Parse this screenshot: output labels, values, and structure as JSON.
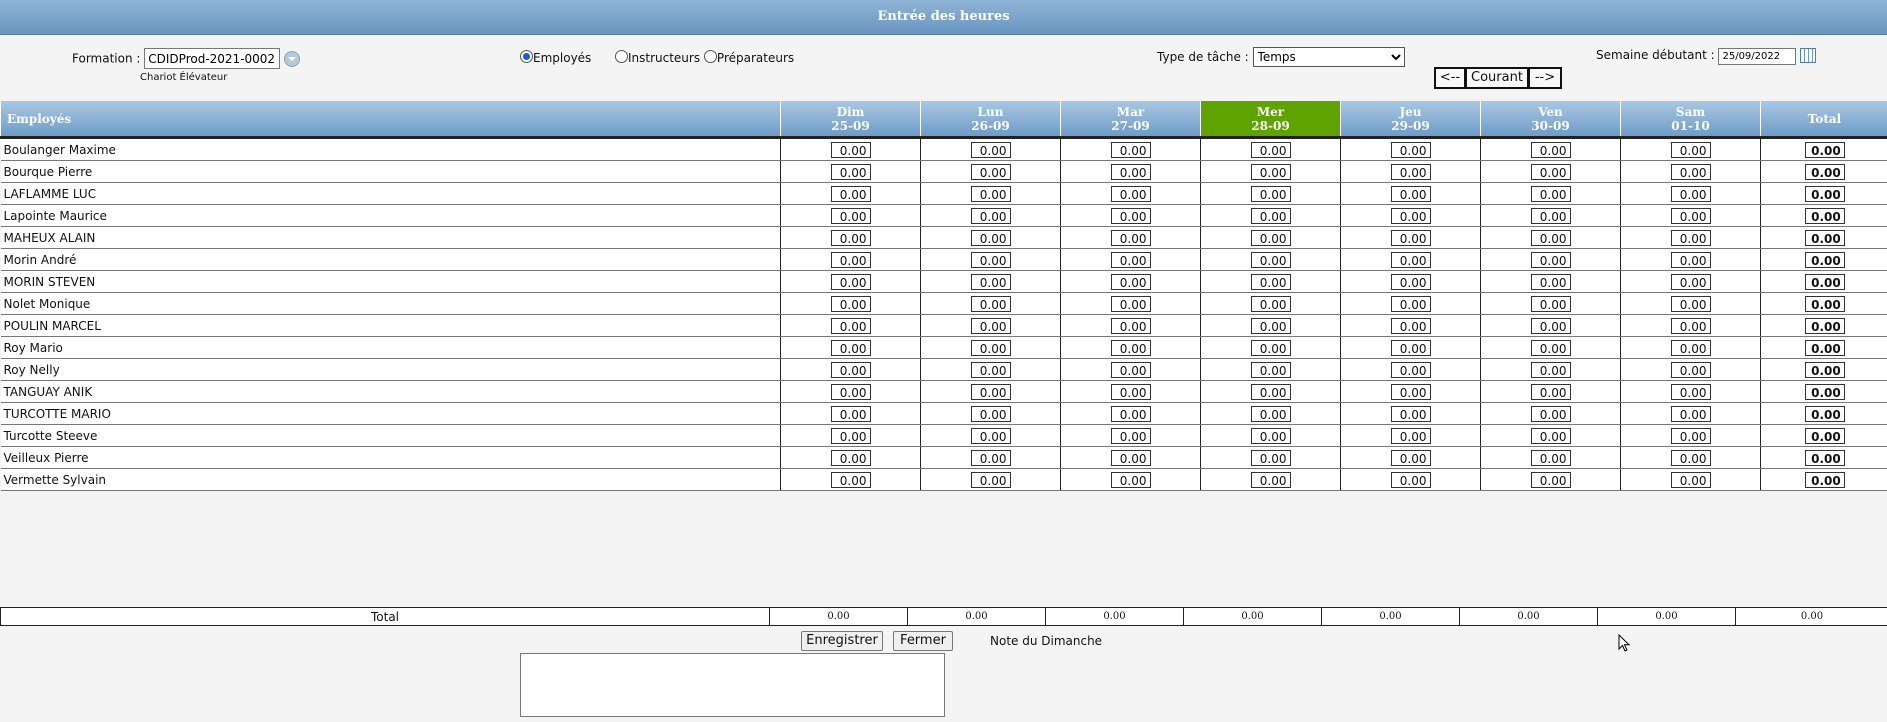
{
  "title": "Entrée des heures",
  "formation": {
    "label": "Formation :",
    "value": "CDIDProd-2021-0002",
    "subtitle": "Chariot Élévateur"
  },
  "radios": [
    {
      "label": "Employés",
      "checked": true
    },
    {
      "label": "Instructeurs",
      "checked": false
    },
    {
      "label": "Préparateurs",
      "checked": false
    }
  ],
  "task_type": {
    "label": "Type de tâche :",
    "value": "Temps"
  },
  "week": {
    "label": "Semaine débutant :",
    "value": "25/09/2022"
  },
  "nav": {
    "prev": "<--",
    "current": "Courant",
    "next": "-->"
  },
  "table": {
    "header_label": "Employés",
    "days": [
      {
        "day": "Dim",
        "date": "25-09",
        "today": false
      },
      {
        "day": "Lun",
        "date": "26-09",
        "today": false
      },
      {
        "day": "Mar",
        "date": "27-09",
        "today": false
      },
      {
        "day": "Mer",
        "date": "28-09",
        "today": true
      },
      {
        "day": "Jeu",
        "date": "29-09",
        "today": false
      },
      {
        "day": "Ven",
        "date": "30-09",
        "today": false
      },
      {
        "day": "Sam",
        "date": "01-10",
        "today": false
      }
    ],
    "total_label": "Total",
    "rows": [
      {
        "name": "Boulanger Maxime",
        "hours": [
          "0.00",
          "0.00",
          "0.00",
          "0.00",
          "0.00",
          "0.00",
          "0.00"
        ],
        "total": "0.00"
      },
      {
        "name": "Bourque Pierre",
        "hours": [
          "0.00",
          "0.00",
          "0.00",
          "0.00",
          "0.00",
          "0.00",
          "0.00"
        ],
        "total": "0.00"
      },
      {
        "name": "LAFLAMME LUC",
        "hours": [
          "0.00",
          "0.00",
          "0.00",
          "0.00",
          "0.00",
          "0.00",
          "0.00"
        ],
        "total": "0.00"
      },
      {
        "name": "Lapointe Maurice",
        "hours": [
          "0.00",
          "0.00",
          "0.00",
          "0.00",
          "0.00",
          "0.00",
          "0.00"
        ],
        "total": "0.00"
      },
      {
        "name": "MAHEUX ALAIN",
        "hours": [
          "0.00",
          "0.00",
          "0.00",
          "0.00",
          "0.00",
          "0.00",
          "0.00"
        ],
        "total": "0.00"
      },
      {
        "name": "Morin André",
        "hours": [
          "0.00",
          "0.00",
          "0.00",
          "0.00",
          "0.00",
          "0.00",
          "0.00"
        ],
        "total": "0.00"
      },
      {
        "name": "MORIN STEVEN",
        "hours": [
          "0.00",
          "0.00",
          "0.00",
          "0.00",
          "0.00",
          "0.00",
          "0.00"
        ],
        "total": "0.00"
      },
      {
        "name": "Nolet Monique",
        "hours": [
          "0.00",
          "0.00",
          "0.00",
          "0.00",
          "0.00",
          "0.00",
          "0.00"
        ],
        "total": "0.00"
      },
      {
        "name": "POULIN MARCEL",
        "hours": [
          "0.00",
          "0.00",
          "0.00",
          "0.00",
          "0.00",
          "0.00",
          "0.00"
        ],
        "total": "0.00"
      },
      {
        "name": "Roy Mario",
        "hours": [
          "0.00",
          "0.00",
          "0.00",
          "0.00",
          "0.00",
          "0.00",
          "0.00"
        ],
        "total": "0.00"
      },
      {
        "name": "Roy Nelly",
        "hours": [
          "0.00",
          "0.00",
          "0.00",
          "0.00",
          "0.00",
          "0.00",
          "0.00"
        ],
        "total": "0.00"
      },
      {
        "name": "TANGUAY ANIK",
        "hours": [
          "0.00",
          "0.00",
          "0.00",
          "0.00",
          "0.00",
          "0.00",
          "0.00"
        ],
        "total": "0.00"
      },
      {
        "name": "TURCOTTE MARIO",
        "hours": [
          "0.00",
          "0.00",
          "0.00",
          "0.00",
          "0.00",
          "0.00",
          "0.00"
        ],
        "total": "0.00"
      },
      {
        "name": "Turcotte Steeve",
        "hours": [
          "0.00",
          "0.00",
          "0.00",
          "0.00",
          "0.00",
          "0.00",
          "0.00"
        ],
        "total": "0.00"
      },
      {
        "name": "Veilleux Pierre",
        "hours": [
          "0.00",
          "0.00",
          "0.00",
          "0.00",
          "0.00",
          "0.00",
          "0.00"
        ],
        "total": "0.00"
      },
      {
        "name": "Vermette Sylvain",
        "hours": [
          "0.00",
          "0.00",
          "0.00",
          "0.00",
          "0.00",
          "0.00",
          "0.00"
        ],
        "total": "0.00"
      }
    ]
  },
  "totals": {
    "label": "Total",
    "values": [
      "0.00",
      "0.00",
      "0.00",
      "0.00",
      "0.00",
      "0.00",
      "0.00",
      "0.00"
    ]
  },
  "buttons": {
    "save": "Enregistrer",
    "close": "Fermer"
  },
  "note": {
    "label": "Note du Dimanche",
    "value": ""
  },
  "colors": {
    "header_blue": "#7aa3cc",
    "today_green": "#5fa300"
  }
}
